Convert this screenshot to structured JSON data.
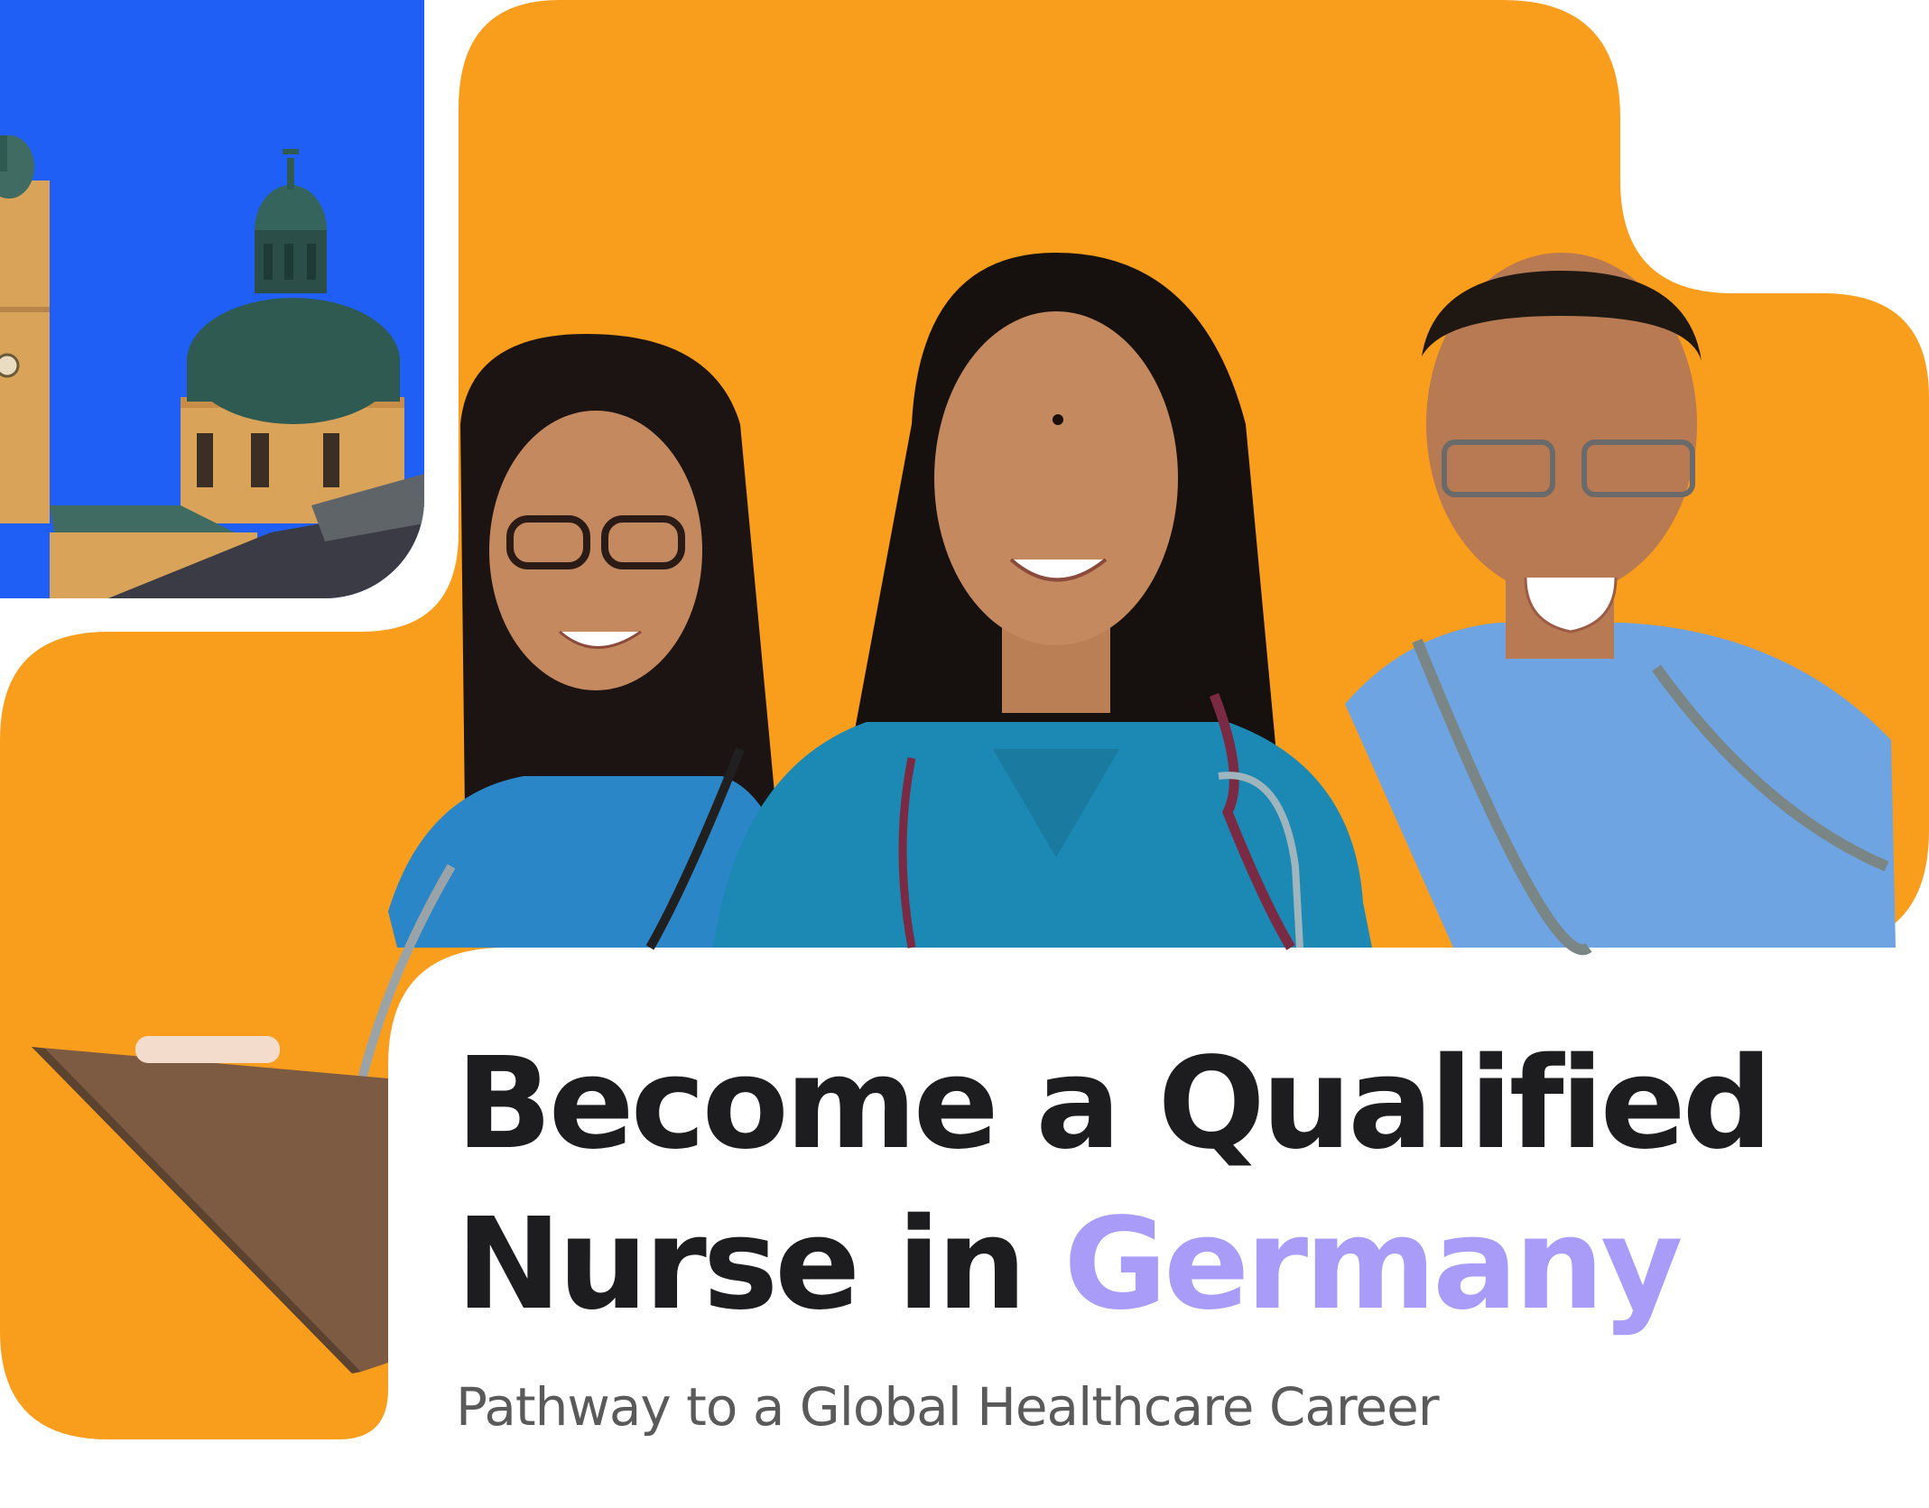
{
  "heading": {
    "line1": "Become a Qualified",
    "line2_prefix": "Nurse in ",
    "line2_accent": "Germany"
  },
  "subtitle": "Pathway to a Global Healthcare Career",
  "colors": {
    "orange": "#f99d1c",
    "sky": "#1f5ff5",
    "accent": "#a89cf8",
    "text": "#1d1d1f",
    "subtitle": "#5a5a5a"
  },
  "images": {
    "landmark": "baroque-church-dome-photo",
    "people": "three-nurses-in-scrubs-photo"
  }
}
